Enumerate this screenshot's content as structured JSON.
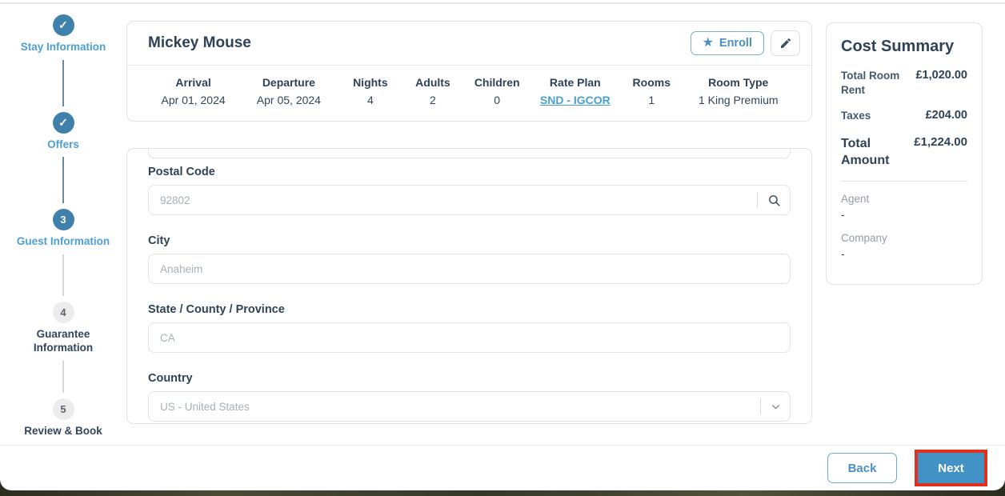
{
  "stepper": {
    "steps": [
      {
        "label": "Stay Information",
        "state": "done"
      },
      {
        "label": "Offers",
        "state": "done"
      },
      {
        "label": "Guest Information",
        "number": "3",
        "state": "current"
      },
      {
        "label": "Guarantee Information",
        "number": "4",
        "state": "upcoming"
      },
      {
        "label": "Review & Book",
        "number": "5",
        "state": "upcoming"
      }
    ]
  },
  "icons": {
    "check": "✓",
    "star": "★"
  },
  "guest_card": {
    "name": "Mickey Mouse",
    "enroll_label": "Enroll",
    "details": [
      {
        "label": "Arrival",
        "value": "Apr 01, 2024"
      },
      {
        "label": "Departure",
        "value": "Apr 05, 2024"
      },
      {
        "label": "Nights",
        "value": "4"
      },
      {
        "label": "Adults",
        "value": "2"
      },
      {
        "label": "Children",
        "value": "0"
      },
      {
        "label": "Rate Plan",
        "value": "SND - IGCOR"
      },
      {
        "label": "Rooms",
        "value": "1"
      },
      {
        "label": "Room Type",
        "value": "1 King Premium"
      }
    ]
  },
  "form": {
    "fields": [
      {
        "label": "Postal Code",
        "placeholder": "92802"
      },
      {
        "label": "City",
        "placeholder": "Anaheim"
      },
      {
        "label": "State / County / Province",
        "placeholder": "CA"
      },
      {
        "label": "Country",
        "placeholder": "US - United States"
      }
    ]
  },
  "cost_summary": {
    "title": "Cost Summary",
    "rows": [
      {
        "label": "Total Room Rent",
        "value": "£1,020.00"
      },
      {
        "label": "Taxes",
        "value": "£204.00"
      }
    ],
    "total_label": "Total Amount",
    "total_value": "£1,224.00",
    "agent_label": "Agent",
    "agent_value": "-",
    "company_label": "Company",
    "company_value": "-"
  },
  "footer": {
    "back_label": "Back",
    "next_label": "Next"
  },
  "colors": {
    "accent_blue": "#4a90c2",
    "step_circle_blue": "#3f81aa",
    "link_blue": "#4a9fd4",
    "next_button_blue": "#4292c6",
    "annotation_red": "#e2301d",
    "text_dark": "#2f4256"
  }
}
